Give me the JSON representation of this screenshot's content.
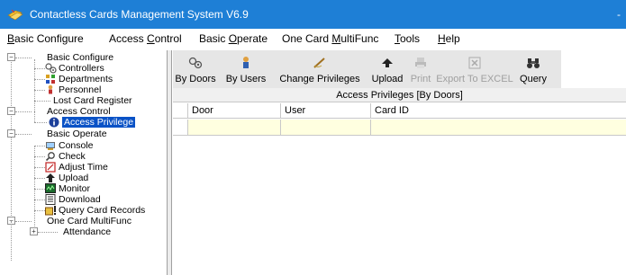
{
  "window": {
    "title": "Contactless Cards Management System  V6.9",
    "close_glyph": "-"
  },
  "menu": [
    {
      "label": "Basic Configure",
      "key": "B"
    },
    {
      "label": "Access Control",
      "key": "C"
    },
    {
      "label": "Basic Operate",
      "key": "O"
    },
    {
      "label": "One Card MultiFunc",
      "key": "M"
    },
    {
      "label": "Tools",
      "key": "T"
    },
    {
      "label": "Help",
      "key": "H"
    }
  ],
  "tree": {
    "groups": [
      {
        "label": "Basic Configure",
        "items": [
          "Controllers",
          "Departments",
          "Personnel",
          "Lost Card Register"
        ]
      },
      {
        "label": "Access Control",
        "items": [
          "Access Privilege"
        ]
      },
      {
        "label": "Basic Operate",
        "items": [
          "Console",
          "Check",
          "Adjust Time",
          "Upload",
          "Monitor",
          "Download",
          "Query Card Records"
        ]
      },
      {
        "label": "One Card MultiFunc",
        "items": [
          "Attendance"
        ]
      }
    ],
    "selected": "Access Privilege"
  },
  "toolbar": [
    {
      "label": "By Doors",
      "icon": "doors-icon",
      "enabled": true
    },
    {
      "label": "By Users",
      "icon": "users-icon",
      "enabled": true
    },
    {
      "label": "Change Privileges",
      "icon": "edit-privileges-icon",
      "enabled": true
    },
    {
      "label": "Upload",
      "icon": "upload-icon",
      "enabled": true
    },
    {
      "label": "Print",
      "icon": "print-icon",
      "enabled": false
    },
    {
      "label": "Export To EXCEL",
      "icon": "excel-icon",
      "enabled": false
    },
    {
      "label": "Query",
      "icon": "binoculars-icon",
      "enabled": true
    }
  ],
  "grid": {
    "title": "Access Privileges [By Doors]",
    "columns": [
      "Door",
      "User",
      "Card ID"
    ]
  },
  "colors": {
    "titlebar": "#1e7fd6",
    "selection": "#0a52c6",
    "row_highlight": "#ffffe0",
    "toolbar_bg": "#e6e6e6"
  }
}
